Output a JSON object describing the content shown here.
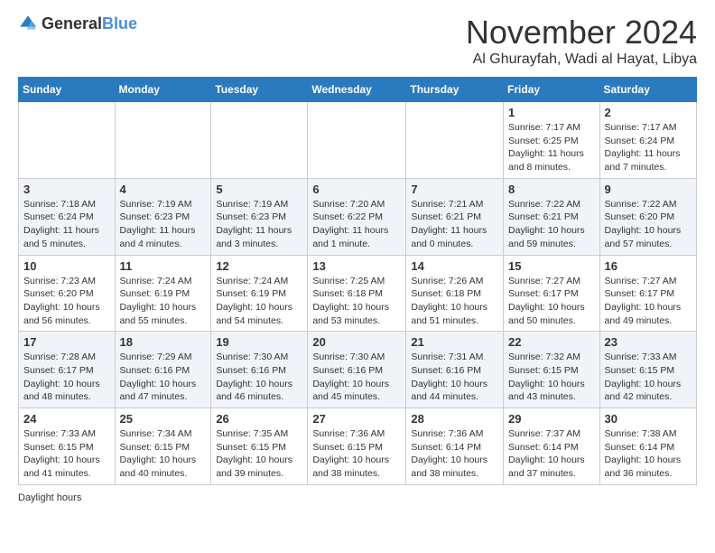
{
  "header": {
    "logo_general": "General",
    "logo_blue": "Blue",
    "month_title": "November 2024",
    "location": "Al Ghurayfah, Wadi al Hayat, Libya"
  },
  "days_of_week": [
    "Sunday",
    "Monday",
    "Tuesday",
    "Wednesday",
    "Thursday",
    "Friday",
    "Saturday"
  ],
  "weeks": [
    [
      {
        "day": "",
        "info": ""
      },
      {
        "day": "",
        "info": ""
      },
      {
        "day": "",
        "info": ""
      },
      {
        "day": "",
        "info": ""
      },
      {
        "day": "",
        "info": ""
      },
      {
        "day": "1",
        "info": "Sunrise: 7:17 AM\nSunset: 6:25 PM\nDaylight: 11 hours and 8 minutes."
      },
      {
        "day": "2",
        "info": "Sunrise: 7:17 AM\nSunset: 6:24 PM\nDaylight: 11 hours and 7 minutes."
      }
    ],
    [
      {
        "day": "3",
        "info": "Sunrise: 7:18 AM\nSunset: 6:24 PM\nDaylight: 11 hours and 5 minutes."
      },
      {
        "day": "4",
        "info": "Sunrise: 7:19 AM\nSunset: 6:23 PM\nDaylight: 11 hours and 4 minutes."
      },
      {
        "day": "5",
        "info": "Sunrise: 7:19 AM\nSunset: 6:23 PM\nDaylight: 11 hours and 3 minutes."
      },
      {
        "day": "6",
        "info": "Sunrise: 7:20 AM\nSunset: 6:22 PM\nDaylight: 11 hours and 1 minute."
      },
      {
        "day": "7",
        "info": "Sunrise: 7:21 AM\nSunset: 6:21 PM\nDaylight: 11 hours and 0 minutes."
      },
      {
        "day": "8",
        "info": "Sunrise: 7:22 AM\nSunset: 6:21 PM\nDaylight: 10 hours and 59 minutes."
      },
      {
        "day": "9",
        "info": "Sunrise: 7:22 AM\nSunset: 6:20 PM\nDaylight: 10 hours and 57 minutes."
      }
    ],
    [
      {
        "day": "10",
        "info": "Sunrise: 7:23 AM\nSunset: 6:20 PM\nDaylight: 10 hours and 56 minutes."
      },
      {
        "day": "11",
        "info": "Sunrise: 7:24 AM\nSunset: 6:19 PM\nDaylight: 10 hours and 55 minutes."
      },
      {
        "day": "12",
        "info": "Sunrise: 7:24 AM\nSunset: 6:19 PM\nDaylight: 10 hours and 54 minutes."
      },
      {
        "day": "13",
        "info": "Sunrise: 7:25 AM\nSunset: 6:18 PM\nDaylight: 10 hours and 53 minutes."
      },
      {
        "day": "14",
        "info": "Sunrise: 7:26 AM\nSunset: 6:18 PM\nDaylight: 10 hours and 51 minutes."
      },
      {
        "day": "15",
        "info": "Sunrise: 7:27 AM\nSunset: 6:17 PM\nDaylight: 10 hours and 50 minutes."
      },
      {
        "day": "16",
        "info": "Sunrise: 7:27 AM\nSunset: 6:17 PM\nDaylight: 10 hours and 49 minutes."
      }
    ],
    [
      {
        "day": "17",
        "info": "Sunrise: 7:28 AM\nSunset: 6:17 PM\nDaylight: 10 hours and 48 minutes."
      },
      {
        "day": "18",
        "info": "Sunrise: 7:29 AM\nSunset: 6:16 PM\nDaylight: 10 hours and 47 minutes."
      },
      {
        "day": "19",
        "info": "Sunrise: 7:30 AM\nSunset: 6:16 PM\nDaylight: 10 hours and 46 minutes."
      },
      {
        "day": "20",
        "info": "Sunrise: 7:30 AM\nSunset: 6:16 PM\nDaylight: 10 hours and 45 minutes."
      },
      {
        "day": "21",
        "info": "Sunrise: 7:31 AM\nSunset: 6:16 PM\nDaylight: 10 hours and 44 minutes."
      },
      {
        "day": "22",
        "info": "Sunrise: 7:32 AM\nSunset: 6:15 PM\nDaylight: 10 hours and 43 minutes."
      },
      {
        "day": "23",
        "info": "Sunrise: 7:33 AM\nSunset: 6:15 PM\nDaylight: 10 hours and 42 minutes."
      }
    ],
    [
      {
        "day": "24",
        "info": "Sunrise: 7:33 AM\nSunset: 6:15 PM\nDaylight: 10 hours and 41 minutes."
      },
      {
        "day": "25",
        "info": "Sunrise: 7:34 AM\nSunset: 6:15 PM\nDaylight: 10 hours and 40 minutes."
      },
      {
        "day": "26",
        "info": "Sunrise: 7:35 AM\nSunset: 6:15 PM\nDaylight: 10 hours and 39 minutes."
      },
      {
        "day": "27",
        "info": "Sunrise: 7:36 AM\nSunset: 6:15 PM\nDaylight: 10 hours and 38 minutes."
      },
      {
        "day": "28",
        "info": "Sunrise: 7:36 AM\nSunset: 6:14 PM\nDaylight: 10 hours and 38 minutes."
      },
      {
        "day": "29",
        "info": "Sunrise: 7:37 AM\nSunset: 6:14 PM\nDaylight: 10 hours and 37 minutes."
      },
      {
        "day": "30",
        "info": "Sunrise: 7:38 AM\nSunset: 6:14 PM\nDaylight: 10 hours and 36 minutes."
      }
    ]
  ],
  "footer": {
    "daylight_label": "Daylight hours"
  }
}
